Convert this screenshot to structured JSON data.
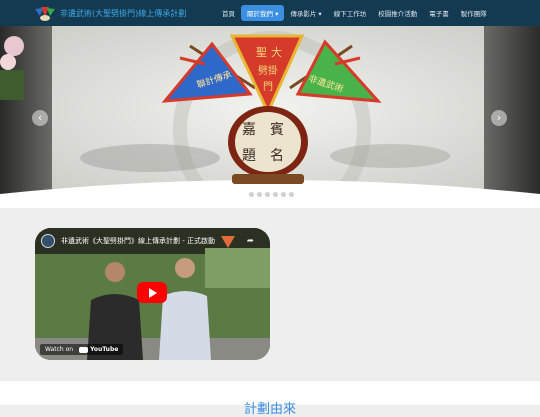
{
  "navbar": {
    "brand_title": "非遺武術(大聖劈掛門)線上傳承計劃",
    "items": [
      {
        "label": "首頁"
      },
      {
        "label": "關於我們 ▾"
      },
      {
        "label": "傳承影片 ▾"
      },
      {
        "label": "線下工作坊"
      },
      {
        "label": "校園推介活動"
      },
      {
        "label": "電子書"
      },
      {
        "label": "製作團隊"
      }
    ],
    "active_index": 1
  },
  "hero": {
    "banner_center": "聖劈掛門",
    "banner_left": "聯計傳承",
    "banner_right": "非遺武術",
    "plaque_text": "嘉賓題名",
    "arrow_prev": "‹",
    "arrow_next": "›",
    "slide_count": 7,
    "active_slide": 0
  },
  "video": {
    "title": "非遺武術《大聖劈掛門》線上傳承計劃 - 正式啟動",
    "share_icon": "share-icon",
    "watch_on": "Watch on",
    "youtube_label": "YouTube"
  },
  "next_section": {
    "heading": "計劃由來"
  },
  "colors": {
    "navbar_bg": "#143a52",
    "brand_text": "#3ea7e6",
    "active_nav": "#3b8fe0",
    "heading": "#3b8fe0"
  }
}
